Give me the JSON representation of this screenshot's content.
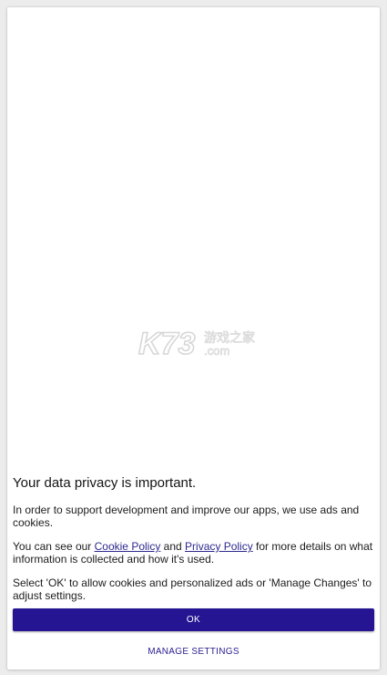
{
  "watermark": {
    "logo_text": "K73",
    "site_name": "游戏之家",
    "domain": ".com"
  },
  "consent": {
    "title": "Your data privacy is important.",
    "paragraph1": "In order to support development and improve our apps, we use ads and cookies.",
    "paragraph2_before": "You can see our ",
    "cookie_policy_link": "Cookie Policy",
    "paragraph2_and": " and ",
    "privacy_policy_link": "Privacy Policy",
    "paragraph2_after": " for more details on what information is collected and how it's used.",
    "paragraph3": "Select 'OK' to allow cookies and personalized ads or 'Manage Changes' to adjust settings."
  },
  "buttons": {
    "ok_label": "OK",
    "manage_label": "MANAGE SETTINGS"
  },
  "colors": {
    "primary": "#251592",
    "link": "#2d2a8f",
    "background": "#ffffff"
  }
}
